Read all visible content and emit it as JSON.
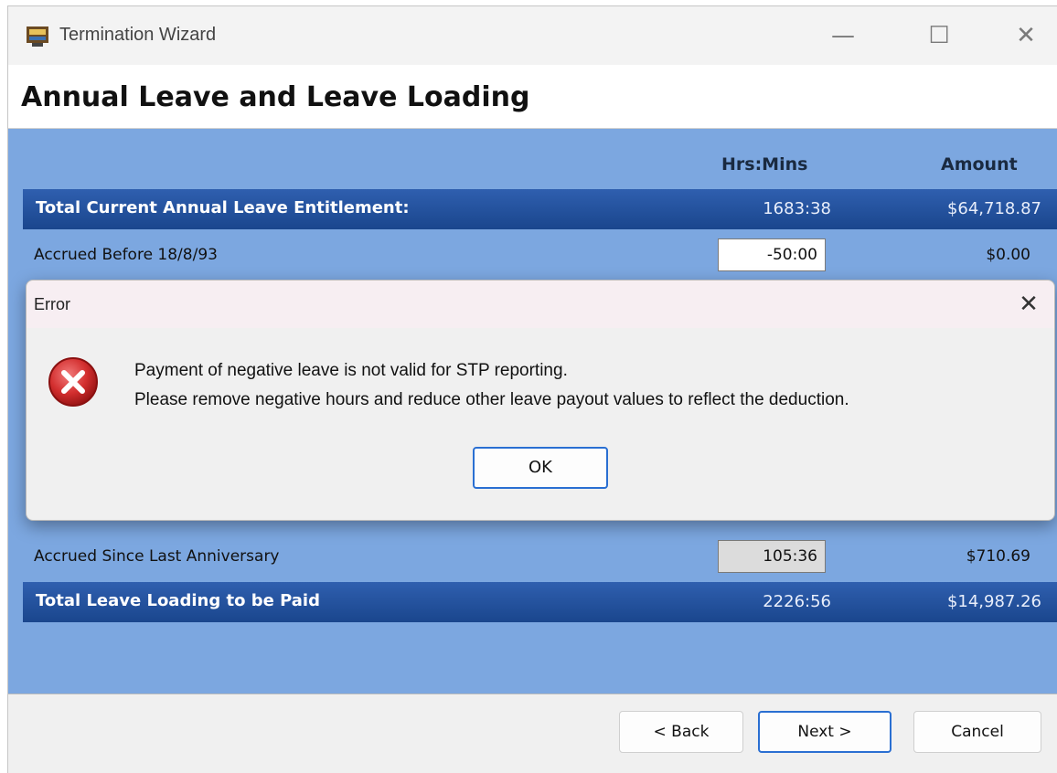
{
  "window": {
    "title": "Termination Wizard",
    "minimize_glyph": "—",
    "maximize_glyph": "☐",
    "close_glyph": "✕"
  },
  "page": {
    "heading": "Annual Leave and Leave Loading"
  },
  "columns": {
    "hours": "Hrs:Mins",
    "amount": "Amount"
  },
  "rows": {
    "total_entitlement": {
      "label": "Total Current Annual Leave Entitlement:",
      "hours": "1683:38",
      "amount": "$64,718.87"
    },
    "accrued_before": {
      "label": "Accrued Before 18/8/93",
      "hours": "-50:00",
      "amount": "$0.00"
    },
    "accrued_since": {
      "label": "Accrued Since Last Anniversary",
      "hours": "105:36",
      "amount": "$710.69"
    },
    "total_loading": {
      "label": "Total Leave Loading to be Paid",
      "hours": "2226:56",
      "amount": "$14,987.26"
    }
  },
  "footer": {
    "back": "< Back",
    "next": "Next >",
    "cancel": "Cancel"
  },
  "dialog": {
    "title": "Error",
    "close_glyph": "✕",
    "message_line1": "Payment of negative leave is not valid for STP reporting.",
    "message_line2": "Please remove negative hours and reduce other leave payout values to reflect the deduction.",
    "ok": "OK",
    "icon": "error-icon"
  },
  "colors": {
    "content_bg": "#7ca7e0",
    "bar_bg": "#1f4f9a",
    "accent": "#2a6fd2",
    "error_red": "#c62828"
  }
}
